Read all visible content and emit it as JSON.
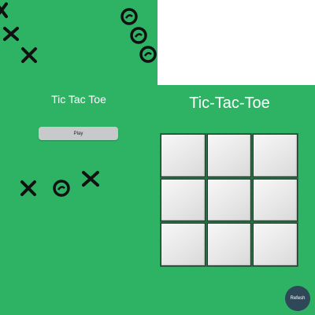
{
  "menu": {
    "title": "Tic Tac Toe",
    "play_label": "Play",
    "decorations": [
      "x-mark-icon",
      "o-mark-icon"
    ]
  },
  "game": {
    "title": "Tic-Tac-Toe",
    "refresh_label": "Refesh",
    "board": [
      [
        "",
        "",
        ""
      ],
      [
        "",
        "",
        ""
      ],
      [
        "",
        "",
        ""
      ]
    ]
  },
  "colors": {
    "background_green": "#2eb365",
    "button_gray": "#c8c9cb",
    "refresh_blue": "#2f4858",
    "mark_black": "#111111"
  }
}
